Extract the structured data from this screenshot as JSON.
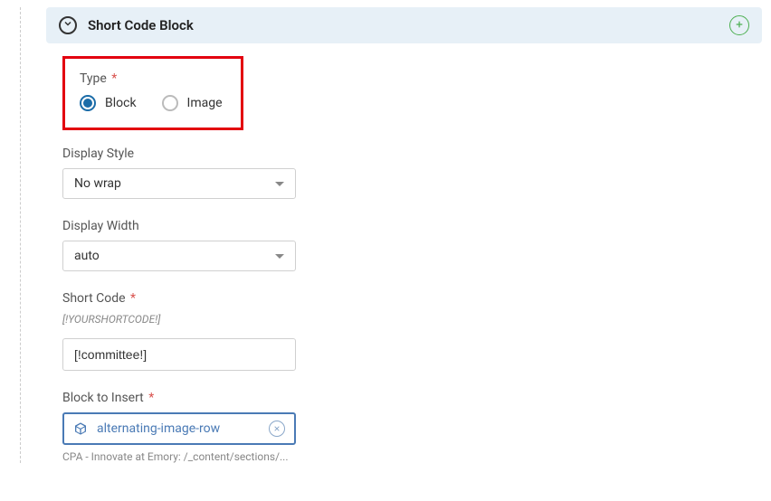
{
  "header": {
    "title": "Short Code Block"
  },
  "type_field": {
    "label": "Type",
    "options": {
      "block": "Block",
      "image": "Image"
    },
    "selected": "block"
  },
  "display_style": {
    "label": "Display Style",
    "value": "No wrap"
  },
  "display_width": {
    "label": "Display Width",
    "value": "auto"
  },
  "short_code": {
    "label": "Short Code",
    "help": "[!YOURSHORTCODE!]",
    "value": "[!committee!]"
  },
  "block_to_insert": {
    "label": "Block to Insert",
    "value": "alternating-image-row",
    "path": "CPA - Innovate at Emory: /_content/sections/..."
  }
}
